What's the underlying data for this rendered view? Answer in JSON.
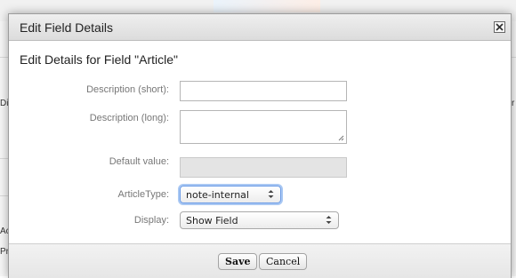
{
  "background": {
    "left_fragments": [
      "Di",
      "Ac",
      "Pr"
    ],
    "right_fragment": "r"
  },
  "dialog": {
    "title": "Edit Field Details",
    "close_icon": "close-icon",
    "subtitle": "Edit Details for Field \"Article\""
  },
  "form": {
    "description_short": {
      "label": "Description (short):",
      "value": ""
    },
    "description_long": {
      "label": "Description (long):",
      "value": ""
    },
    "default_value": {
      "label": "Default value:",
      "value": ""
    },
    "article_type": {
      "label": "ArticleType:",
      "value": "note-internal"
    },
    "display": {
      "label": "Display:",
      "value": "Show Field"
    }
  },
  "footer": {
    "save_label": "Save",
    "cancel_label": "Cancel"
  },
  "colors": {
    "header_bg": "#e3e3e3",
    "focus_ring": "#a9c8f3",
    "disabled_bg": "#e4e4e4"
  }
}
